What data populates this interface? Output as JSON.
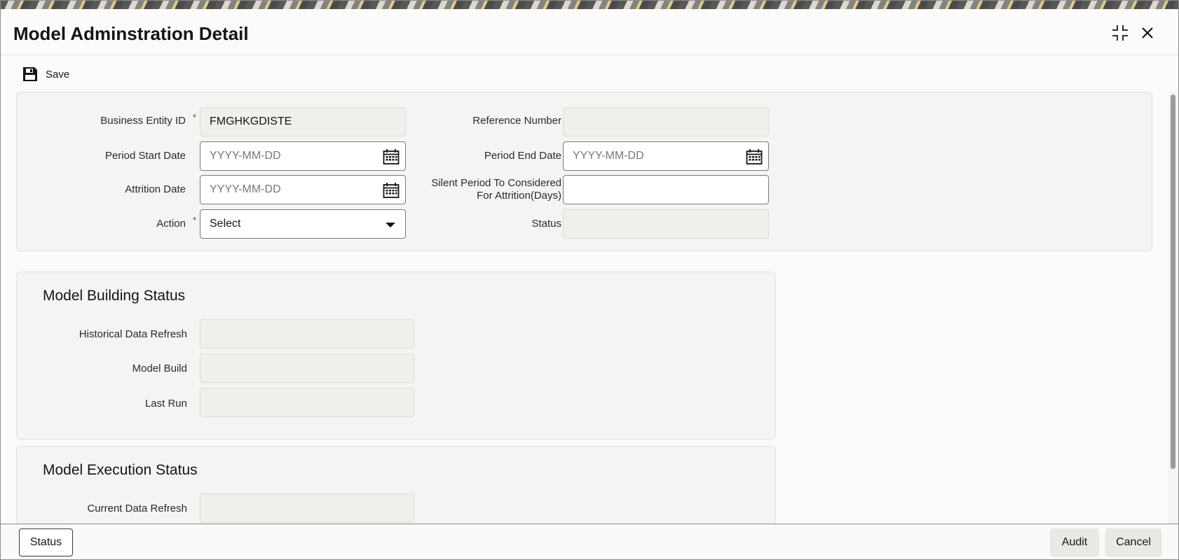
{
  "window": {
    "title": "Model Adminstration Detail",
    "maximize_icon": "collapse-icon",
    "close_icon": "close-icon"
  },
  "toolbar": {
    "save_label": "Save",
    "save_icon": "floppy-disk-icon"
  },
  "main_form": {
    "business_entity_id": {
      "label": "Business Entity ID",
      "required_mark": "*",
      "value": "FMGHKGDISTE"
    },
    "reference_number": {
      "label": "Reference Number",
      "value": ""
    },
    "period_start_date": {
      "label": "Period Start Date",
      "placeholder": "YYYY-MM-DD"
    },
    "period_end_date": {
      "label": "Period End Date",
      "placeholder": "YYYY-MM-DD"
    },
    "attrition_date": {
      "label": "Attrition Date",
      "placeholder": "YYYY-MM-DD"
    },
    "silent_period": {
      "label_line1": "Silent Period To Considered",
      "label_line2": "For Attrition(Days)",
      "value": ""
    },
    "action": {
      "label": "Action",
      "required_mark": "*",
      "value": "Select"
    },
    "status": {
      "label": "Status",
      "value": ""
    }
  },
  "model_building_status": {
    "title": "Model Building Status",
    "historical_data_refresh": {
      "label": "Historical Data Refresh",
      "value": ""
    },
    "model_build": {
      "label": "Model Build",
      "value": ""
    },
    "last_run": {
      "label": "Last Run",
      "value": ""
    }
  },
  "model_execution_status": {
    "title": "Model Execution Status",
    "current_data_refresh": {
      "label": "Current Data Refresh",
      "value": ""
    }
  },
  "footer": {
    "status_label": "Status",
    "audit_label": "Audit",
    "cancel_label": "Cancel"
  }
}
